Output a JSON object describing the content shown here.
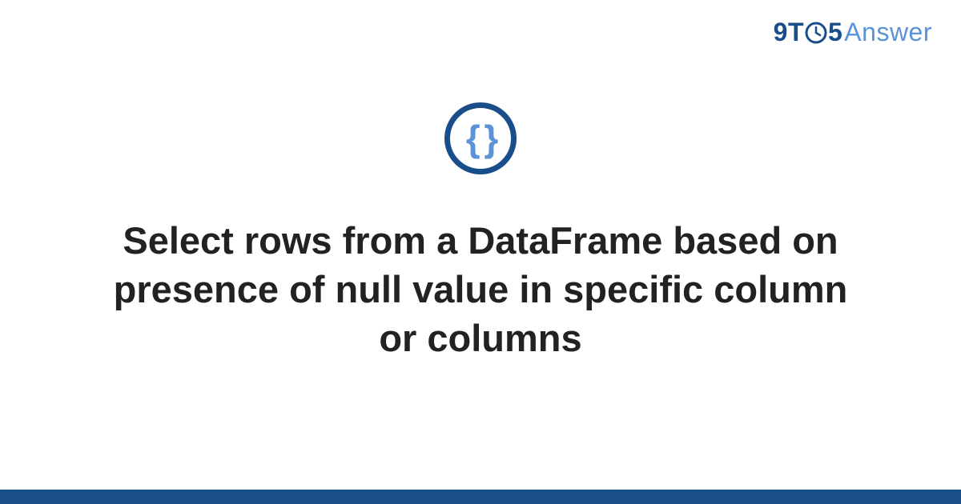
{
  "logo": {
    "part1": "9T",
    "part2": "5",
    "part3": "Answer"
  },
  "icon": {
    "braces": "{ }"
  },
  "question": {
    "title": "Select rows from a DataFrame based on presence of null value in specific column or columns"
  },
  "colors": {
    "primary": "#1a4e8a",
    "secondary": "#5a94d6",
    "text": "#222222"
  }
}
